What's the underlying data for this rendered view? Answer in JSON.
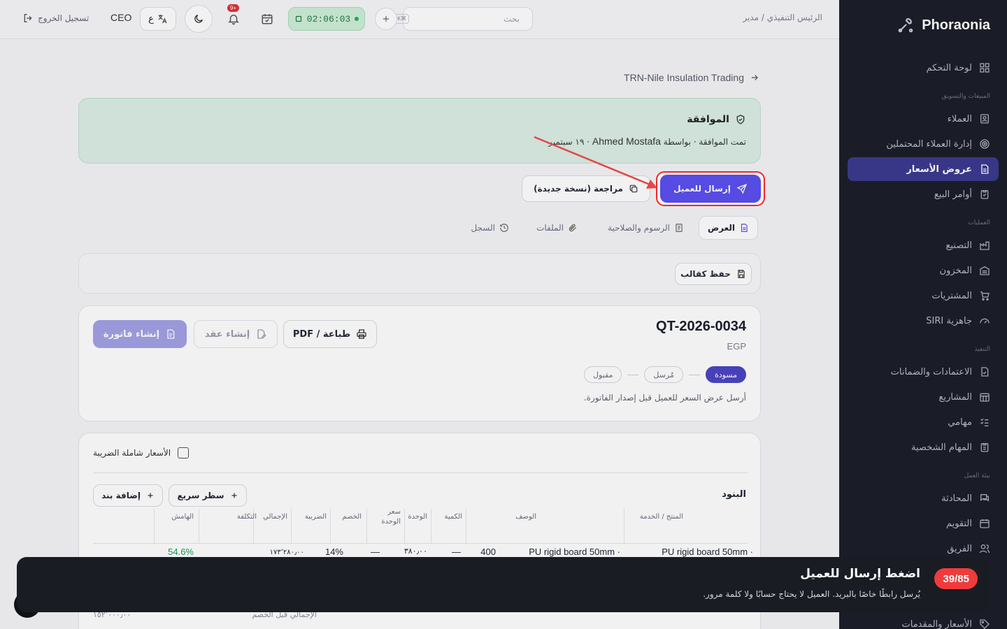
{
  "brand": {
    "name": "Phoraonia"
  },
  "topbar": {
    "breadcrumb": "الرئيس التنفيذي / مدير",
    "search_placeholder": "بحث",
    "search_kbd": "⌘K",
    "timer": "02:06:03",
    "notif_count": "+9",
    "lang_label": "ع",
    "role": "CEO",
    "logout": "تسجيل الخروج"
  },
  "sidebar": {
    "items": [
      {
        "label": "لوحة التحكم",
        "icon": "grid-icon"
      },
      {
        "label": "العملاء",
        "icon": "contacts-icon"
      },
      {
        "label": "إدارة العملاء المحتملين",
        "icon": "target-icon"
      },
      {
        "label": "عروض الأسعار",
        "icon": "document-icon",
        "active": true
      },
      {
        "label": "أوامر البيع",
        "icon": "clipboard-icon"
      },
      {
        "label": "التصنيع",
        "icon": "factory-icon"
      },
      {
        "label": "المخزون",
        "icon": "warehouse-icon"
      },
      {
        "label": "المشتريات",
        "icon": "cart-icon"
      },
      {
        "label": "جاهزية SIRI",
        "icon": "gauge-icon"
      },
      {
        "label": "الاعتمادات والضمانات",
        "icon": "file-check-icon"
      },
      {
        "label": "المشاريع",
        "icon": "calendar-grid-icon"
      },
      {
        "label": "مهامي",
        "icon": "checklist-icon"
      },
      {
        "label": "المهام الشخصية",
        "icon": "clipboard-list-icon"
      },
      {
        "label": "المحادثة",
        "icon": "chat-icon"
      },
      {
        "label": "التقويم",
        "icon": "calendar-icon"
      },
      {
        "label": "الفريق",
        "icon": "users-icon"
      },
      {
        "label": "الأسعار والمقدمات",
        "icon": "tag-icon"
      }
    ]
  },
  "page": {
    "back_crumb": "TRN-Nile Insulation Trading",
    "approval": {
      "title": "الموافقة",
      "desc_prefix": "تمت الموافقة · بواسطة",
      "desc_name": "Ahmed Mostafa",
      "desc_suffix": "· ١٩ سبتمبر"
    },
    "send_button": "إرسال للعميل",
    "revision_button": "مراجعة (نسخة جديدة)",
    "tabs": [
      "العرض",
      "الرسوم والصلاحية",
      "الملفات",
      "السجل"
    ],
    "save_template": "حفظ كقالب",
    "quote": {
      "number": "QT-2026-0034",
      "currency": "EGP",
      "statuses": [
        "مسودة",
        "مُرسل",
        "مقبول"
      ],
      "hint": "أرسل عرض السعر للعميل قبل إصدار الفاتورة.",
      "print_button": "طباعة / PDF",
      "contract_button": "إنشاء عقد",
      "invoice_button": "إنشاء فاتورة"
    },
    "items": {
      "tax_inclusive_label": "الأسعار شاملة الضريبة",
      "title": "البنود",
      "quick_row": "سطر سريع",
      "add_item": "إضافة بند",
      "columns": [
        "المنتج / الخدمة",
        "الوصف",
        "الكمية",
        "الوحدة",
        "سعر الوحدة",
        "الخصم",
        "الضريبة",
        "الإجمالي",
        "التكلفة",
        "الهامش"
      ],
      "row": {
        "product": "PU rigid board 50mm ·",
        "description": "PU rigid board 50mm ·",
        "qty": "400",
        "unit": "—",
        "unit_price": "٣٨٠٫٠٠",
        "discount": "—",
        "tax": "14%",
        "total": "١٧٣٬٢٨٠٫٠٠",
        "margin": "54.6%"
      },
      "subtotal_label": "الإجمالي قبل الخصم",
      "subtotal_value": "١٥٢٬٠٠٠٫٠٠"
    }
  },
  "tour": {
    "step": "39/85",
    "title": "اضغط إرسال للعميل",
    "desc": "يُرسل رابطًا خاصًا بالبريد. العميل لا يحتاج حسابًا ولا كلمة مرور."
  },
  "colors": {
    "accent": "#5b4ff0",
    "sidebar_bg": "#1b1d29",
    "highlight": "#ff2b2b",
    "approval_bg": "#dbeee6"
  }
}
